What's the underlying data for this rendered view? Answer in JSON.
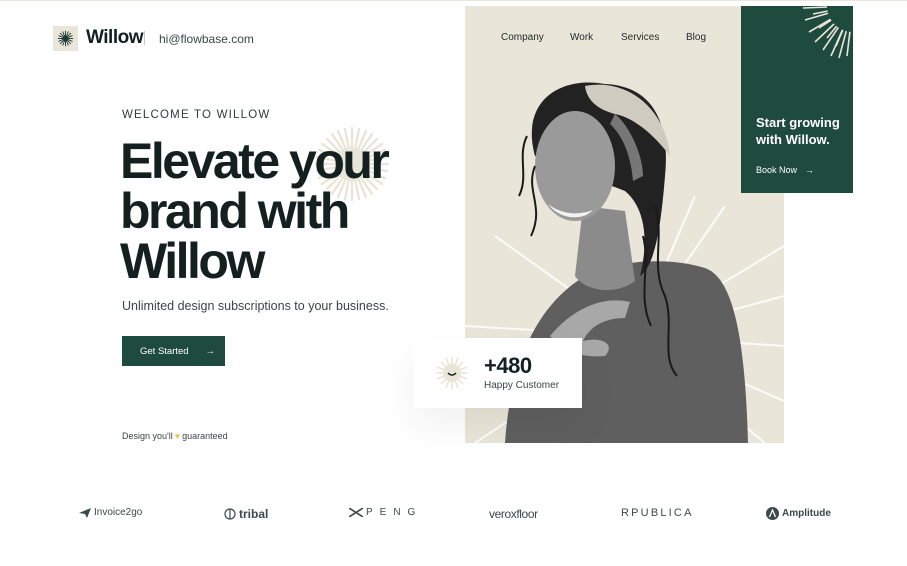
{
  "header": {
    "brand": "Willow",
    "email": "hi@flowbase.com"
  },
  "nav": {
    "items": [
      {
        "label": "Company"
      },
      {
        "label": "Work"
      },
      {
        "label": "Services"
      },
      {
        "label": "Blog"
      }
    ]
  },
  "cta_card": {
    "title": "Start growing with Willow.",
    "link_label": "Book Now",
    "link_icon": "arrow-right-icon"
  },
  "hero": {
    "eyebrow": "WELCOME TO WILLOW",
    "headline_line1": "Elevate your",
    "headline_line2": "brand with",
    "headline_line3": "Willow",
    "subtitle": "Unlimited design subscriptions to your business.",
    "button_label": "Get Started",
    "button_icon": "arrow-right-icon",
    "guarantee_before": "Design you'll",
    "guarantee_icon": "yellow-heart-icon",
    "guarantee_after": "guaranteed"
  },
  "stat": {
    "value": "+480",
    "label": "Happy Customer",
    "icon": "smile-burst-icon"
  },
  "logos": [
    {
      "name": "Invoice2go",
      "icon": "paper-plane-icon"
    },
    {
      "name": "tribal",
      "icon": "tribal-leaf-icon"
    },
    {
      "name": "PENG",
      "icon": "peng-x-icon"
    },
    {
      "name": "veroxfloor",
      "icon": ""
    },
    {
      "name": "RPUBLICA",
      "icon": ""
    },
    {
      "name": "Amplitude",
      "icon": "amplitude-a-icon"
    }
  ],
  "colors": {
    "brand_green": "#1f4a3e",
    "panel_beige": "#e9e5d8",
    "text_dark": "#13201f",
    "heart_yellow": "#e7c45b"
  }
}
